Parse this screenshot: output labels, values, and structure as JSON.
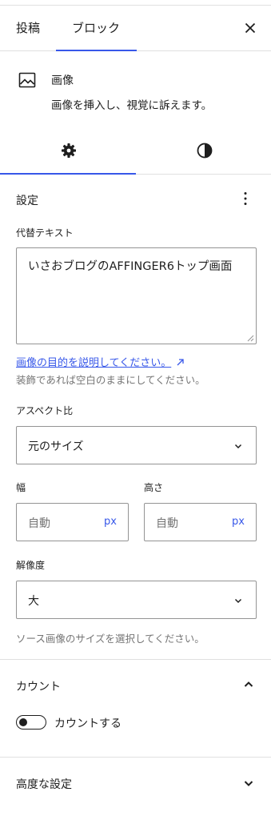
{
  "header": {
    "tab_post": "投稿",
    "tab_block": "ブロック"
  },
  "block": {
    "icon": "image-icon",
    "title": "画像",
    "description": "画像を挿入し、視覚に訴えます。"
  },
  "sub_tabs": {
    "settings_icon": "gear-icon",
    "styles_icon": "contrast-icon"
  },
  "settings": {
    "title": "設定",
    "alt_label": "代替テキスト",
    "alt_value": "いさおブログのAFFINGER6トップ画面",
    "alt_help_link": "画像の目的を説明してください。",
    "alt_help_text": "装飾であれば空白のままにしてください。",
    "aspect_label": "アスペクト比",
    "aspect_value": "元のサイズ",
    "width_label": "幅",
    "height_label": "高さ",
    "width_placeholder": "自動",
    "height_placeholder": "自動",
    "unit": "px",
    "resolution_label": "解像度",
    "resolution_value": "大",
    "resolution_help": "ソース画像のサイズを選択してください。"
  },
  "count_panel": {
    "title": "カウント",
    "toggle_label": "カウントする",
    "toggle_on": false
  },
  "advanced_panel": {
    "title": "高度な設定"
  },
  "colors": {
    "accent": "#3858e9",
    "text": "#1e1e1e",
    "muted": "#757575",
    "border": "#e0e0e0"
  }
}
